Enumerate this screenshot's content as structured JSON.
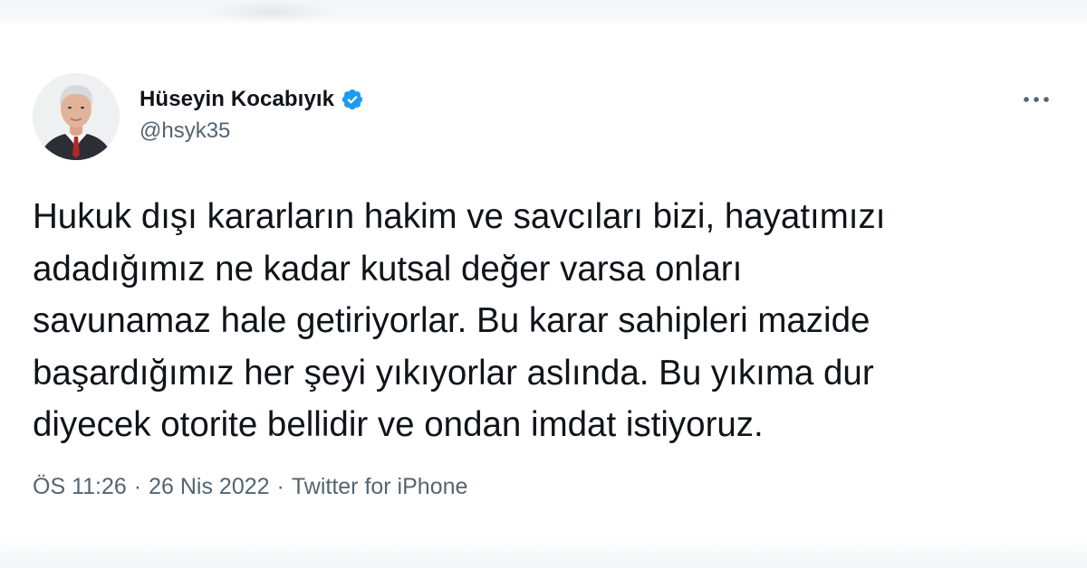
{
  "user": {
    "display_name": "Hüseyin Kocabıyık",
    "handle": "@hsyk35",
    "verified": true
  },
  "tweet": {
    "lines": [
      "Hukuk dışı kararların hakim ve savcıları bizi, hayatımızı",
      "adadığımız ne kadar kutsal değer varsa onları",
      "savunamaz hale getiriyorlar. Bu karar sahipleri mazide",
      "başardığımız her şeyi yıkıyorlar aslında. Bu yıkıma dur",
      "diyecek otorite bellidir ve ondan imdat istiyoruz."
    ]
  },
  "meta": {
    "time": "ÖS 11:26",
    "separator": "·",
    "date": "26 Nis 2022",
    "source": "Twitter for iPhone"
  },
  "icons": {
    "verified": "verified-badge-icon",
    "more": "more-horizontal-icon"
  },
  "colors": {
    "text_primary": "#0f1419",
    "text_secondary": "#536471",
    "verified_blue": "#1d9bf0"
  }
}
